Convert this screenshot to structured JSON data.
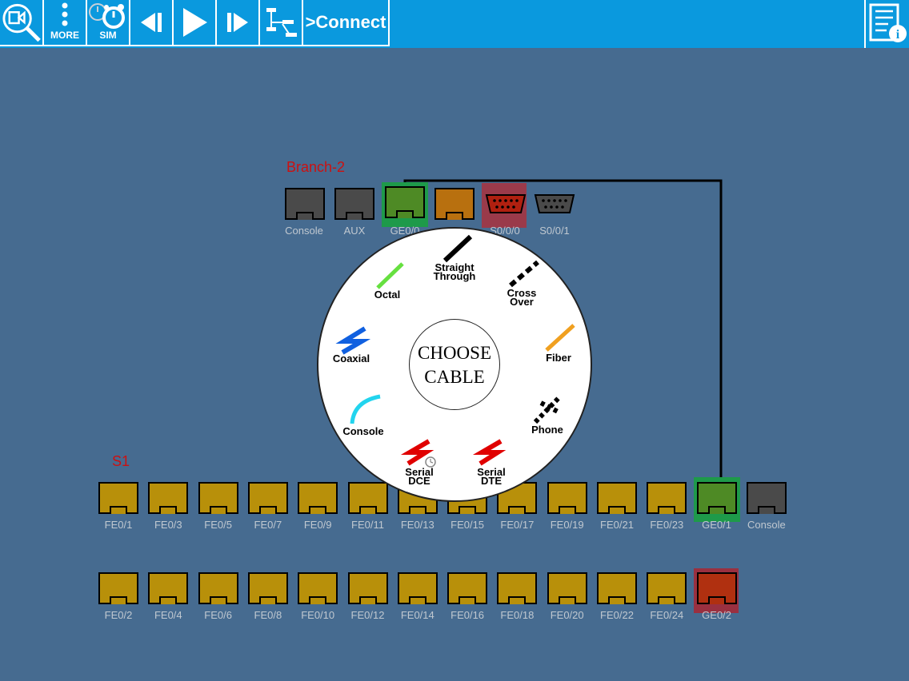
{
  "toolbar": {
    "more_label": "MORE",
    "sim_label": "SIM",
    "connect_label": ">Connect"
  },
  "devices": {
    "branch": {
      "name": "Branch-2",
      "ports": [
        "Console",
        "AUX",
        "GE0/0",
        "",
        "S0/0/0",
        "S0/0/1"
      ]
    },
    "switch": {
      "name": "S1",
      "row1": [
        "FE0/1",
        "FE0/3",
        "FE0/5",
        "FE0/7",
        "FE0/9",
        "FE0/11",
        "FE0/13",
        "FE0/15",
        "FE0/17",
        "FE0/19",
        "FE0/21",
        "FE0/23",
        "GE0/1",
        "Console"
      ],
      "row2": [
        "FE0/2",
        "FE0/4",
        "FE0/6",
        "FE0/8",
        "FE0/10",
        "FE0/12",
        "FE0/14",
        "FE0/16",
        "FE0/18",
        "FE0/20",
        "FE0/22",
        "FE0/24",
        "GE0/2"
      ]
    }
  },
  "cable_menu": {
    "title_line1": "CHOOSE",
    "title_line2": "CABLE",
    "cables": {
      "straight": [
        "Straight",
        "Through"
      ],
      "cross": [
        "Cross",
        "Over"
      ],
      "fiber": "Fiber",
      "phone": "Phone",
      "serial_dte": [
        "Serial",
        "DTE"
      ],
      "serial_dce": [
        "Serial",
        "DCE"
      ],
      "console": "Console",
      "coaxial": "Coaxial",
      "octal": "Octal"
    }
  },
  "colors": {
    "toolbar": "#0a99de",
    "canvas": "#466b90",
    "port_gold": "#b8900a",
    "port_gray": "#4a4a4a",
    "port_green": "#4e8a25",
    "port_orange": "#b8700f",
    "port_red": "#b03010"
  }
}
